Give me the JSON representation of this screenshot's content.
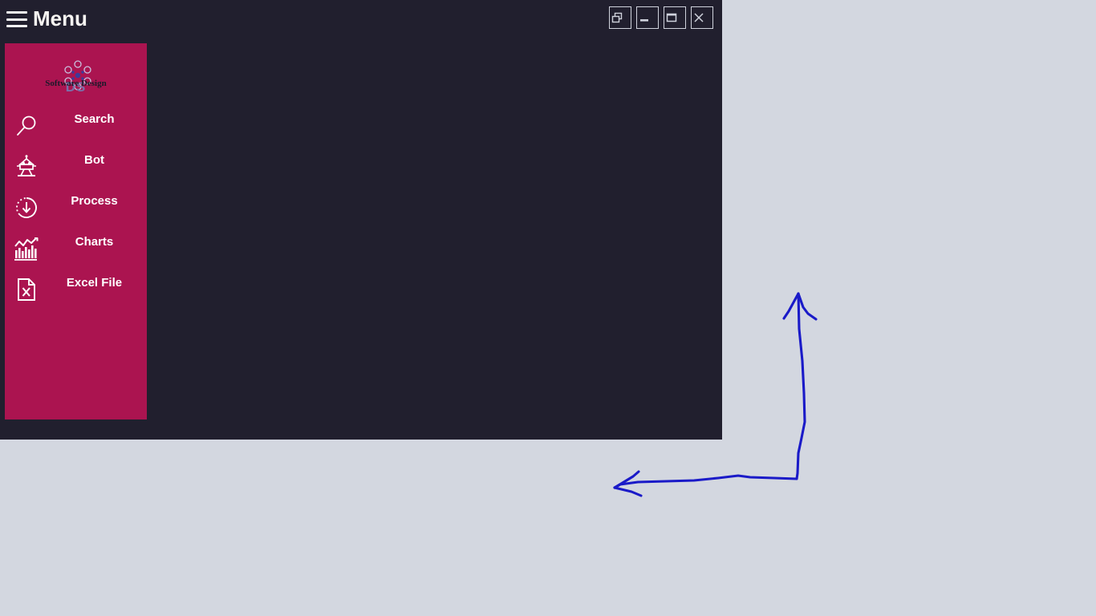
{
  "window": {
    "title": "Menu",
    "hamburger_icon": "hamburger-menu-icon",
    "background_color": "#211f2e",
    "controls": [
      {
        "name": "restore-window-button",
        "icon": "restore-window-icon",
        "tooltip": "Restore"
      },
      {
        "name": "minimize-window-button",
        "icon": "minimize-window-icon",
        "tooltip": "Minimize"
      },
      {
        "name": "maximize-window-button",
        "icon": "maximize-window-icon",
        "tooltip": "Maximize"
      },
      {
        "name": "close-window-button",
        "icon": "close-window-icon",
        "tooltip": "Close"
      }
    ]
  },
  "sidebar": {
    "background_color": "#ab1450",
    "logo": {
      "brand_name": "Software Design",
      "monogram": "DS",
      "mark_icon": "flower-dots-logo-icon",
      "monogram_color": "#7b6fa8"
    },
    "items": [
      {
        "label": "Search",
        "icon": "search-icon"
      },
      {
        "label": "Bot",
        "icon": "robot-icon"
      },
      {
        "label": "Process",
        "icon": "process-refresh-download-icon"
      },
      {
        "label": "Charts",
        "icon": "bar-chart-trend-icon"
      },
      {
        "label": "Excel File",
        "icon": "excel-file-icon"
      }
    ]
  },
  "desktop": {
    "background_color": "#d3d7e0"
  },
  "annotation": {
    "type": "hand-drawn-double-arrow",
    "color": "#1a1ac8",
    "description": "L-shaped double-headed arrow pointing up and left"
  }
}
